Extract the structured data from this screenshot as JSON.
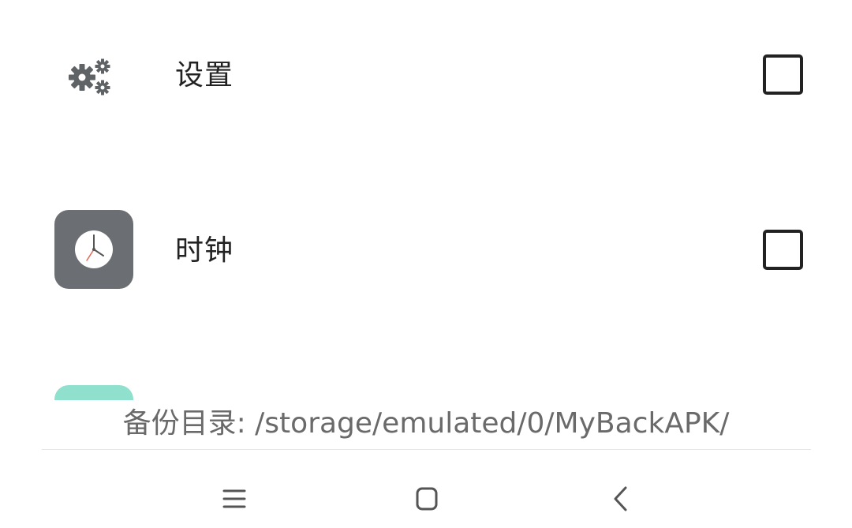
{
  "apps": [
    {
      "name": "设置",
      "icon": "settings-gears-icon",
      "checked": false
    },
    {
      "name": "时钟",
      "icon": "clock-app-icon",
      "checked": false
    },
    {
      "name": "",
      "icon": "teal-app-icon",
      "checked": false
    }
  ],
  "backup": {
    "path_text": "备份目录: /storage/emulated/0/MyBackAPK/"
  },
  "nav": {
    "menu_icon": "menu-icon",
    "home_icon": "home-icon",
    "back_icon": "back-icon"
  },
  "colors": {
    "clock_icon_bg": "#6b6e72",
    "partial_icon_bg": "#8fe0cc",
    "text_primary": "#222222",
    "text_secondary": "#6a6a6a"
  }
}
